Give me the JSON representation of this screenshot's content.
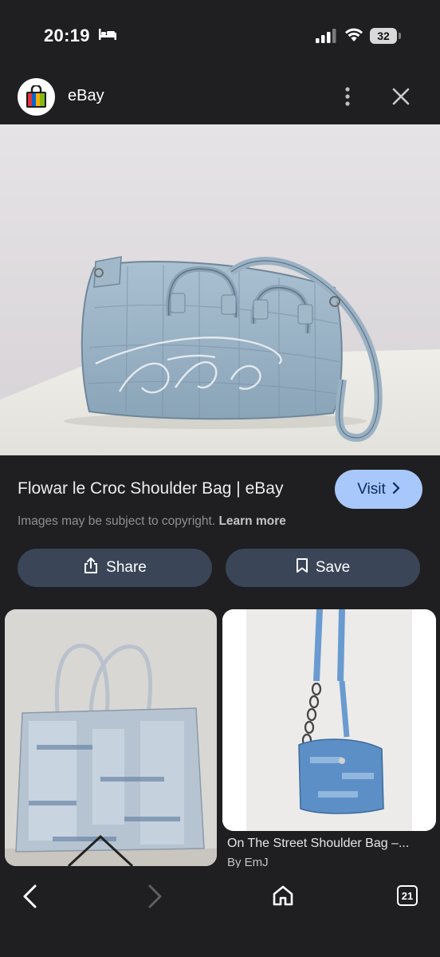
{
  "status_bar": {
    "time": "20:19",
    "battery_level": "32",
    "icons": [
      "bed-icon",
      "signal-icon",
      "wifi-icon",
      "battery-icon"
    ]
  },
  "header": {
    "site_name": "eBay",
    "icons": [
      "ebay-logo-icon",
      "more-vert-icon",
      "close-icon"
    ]
  },
  "result": {
    "title": "Flowar le Croc Shoulder Bag | eBay",
    "visit_label": "Visit",
    "copyright_text": "Images may be subject to copyright.",
    "learn_more_label": "Learn more",
    "share_label": "Share",
    "save_label": "Save"
  },
  "related": [
    {
      "title": "",
      "source": ""
    },
    {
      "title": "On The Street Shoulder Bag –...",
      "source": "By EmJ"
    }
  ],
  "bottom_nav": {
    "tab_count": "21",
    "icons": [
      "back-icon",
      "forward-icon",
      "home-icon",
      "tabs-icon"
    ]
  },
  "colors": {
    "background": "#1f1f21",
    "visit_button": "#a8c7fa",
    "action_button": "#3a4558",
    "bag_blue": "#9bb4c7"
  }
}
